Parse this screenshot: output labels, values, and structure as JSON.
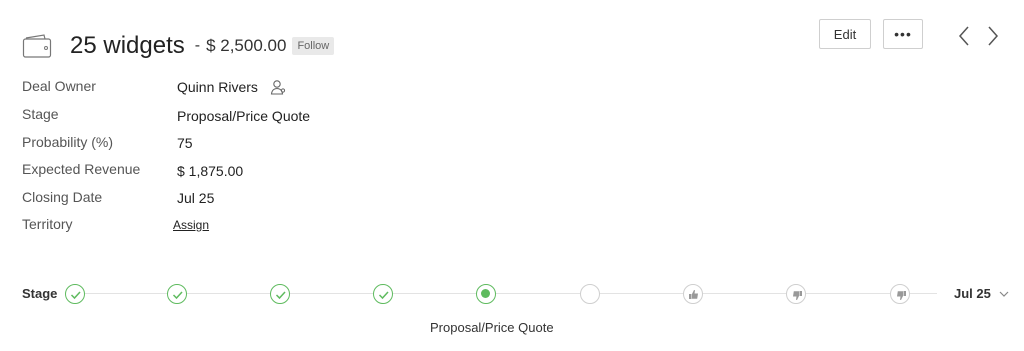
{
  "header": {
    "title": "25 widgets",
    "separator": "-",
    "amount": "$ 2,500.00",
    "follow_label": "Follow",
    "edit_label": "Edit",
    "more_label": "•••",
    "icon": "wallet-icon"
  },
  "fields": {
    "deal_owner": {
      "label": "Deal Owner",
      "value": "Quinn Rivers"
    },
    "stage": {
      "label": "Stage",
      "value": "Proposal/Price Quote"
    },
    "probability": {
      "label": "Probability (%)",
      "value": "75"
    },
    "expected_revenue": {
      "label": "Expected Revenue",
      "value": "$ 1,875.00"
    },
    "closing_date": {
      "label": "Closing Date",
      "value": "Jul 25"
    },
    "territory": {
      "label": "Territory",
      "value": "Assign"
    }
  },
  "stage_bar": {
    "label": "Stage",
    "date": "Jul 25",
    "current_stage": "Proposal/Price Quote",
    "nodes": [
      "completed",
      "completed",
      "completed",
      "completed",
      "current",
      "upcoming",
      "closed-won",
      "closed-lost",
      "closed-lost-competition"
    ]
  },
  "colors": {
    "success": "#5fbb5f",
    "muted": "#cfcfcf"
  }
}
